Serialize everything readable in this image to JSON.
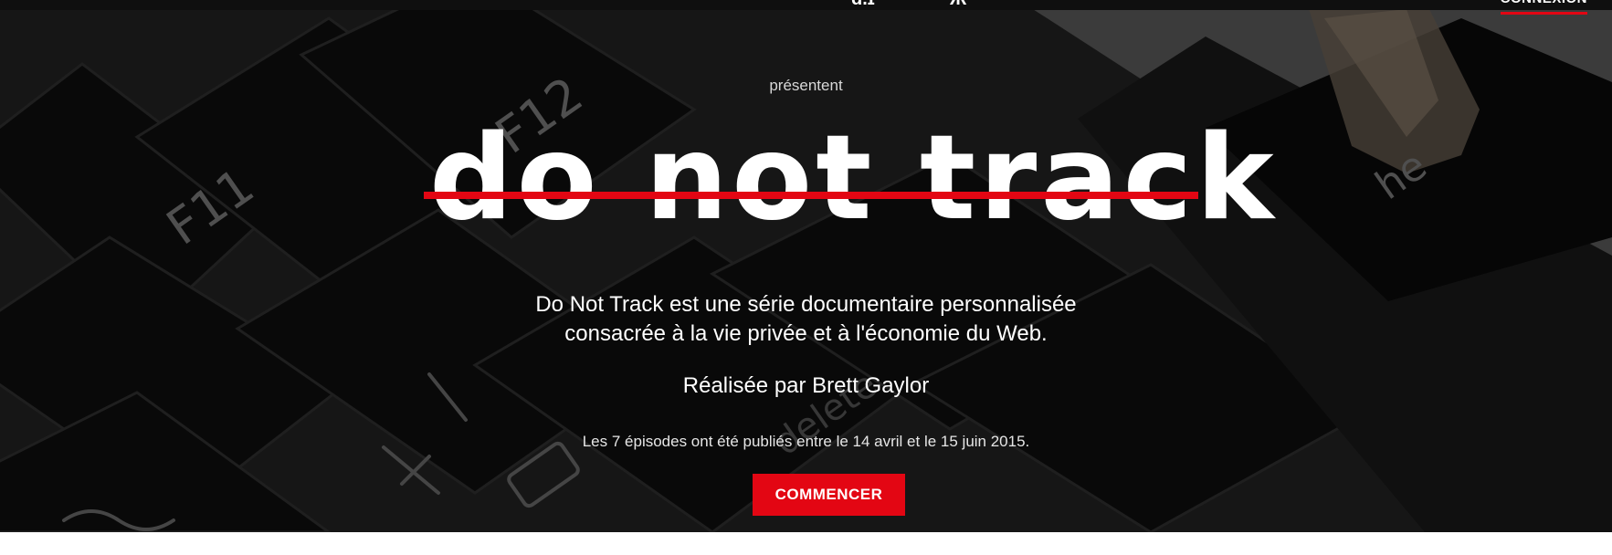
{
  "header": {
    "login_label": "CONNEXION"
  },
  "hero": {
    "presents": "présentent",
    "title": "do not track",
    "description_line1": "Do Not Track est une série documentaire personnalisée",
    "description_line2": "consacrée à la vie privée et à l'économie du Web.",
    "director": "Réalisée par Brett Gaylor",
    "dates": "Les 7 épisodes ont été publiés entre le 14 avril et le 15 juin 2015.",
    "cta_label": "COMMENCER"
  },
  "colors": {
    "accent": "#e30613",
    "background_dark": "#1c1c1c",
    "text": "#ffffff"
  }
}
